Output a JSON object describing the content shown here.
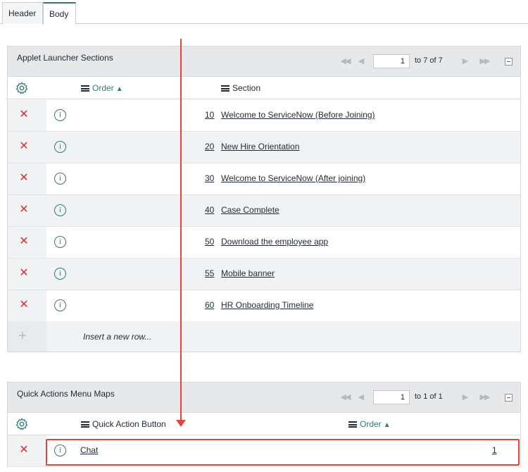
{
  "tabs": [
    {
      "label": "Header"
    },
    {
      "label": "Body"
    }
  ],
  "applet_list": {
    "title": "Applet Launcher Sections",
    "pager": {
      "page_value": "1",
      "count_text": "to 7 of 7"
    },
    "columns": {
      "order": "Order",
      "section": "Section"
    },
    "rows": [
      {
        "order": "10",
        "section": "Welcome to ServiceNow (Before Joining)"
      },
      {
        "order": "20",
        "section": "New Hire Orientation"
      },
      {
        "order": "30",
        "section": "Welcome to ServiceNow (After joining)"
      },
      {
        "order": "40",
        "section": "Case Complete"
      },
      {
        "order": "50",
        "section": "Download the employee app"
      },
      {
        "order": "55",
        "section": "Mobile banner"
      },
      {
        "order": "60",
        "section": "HR Onboarding Timeline"
      }
    ],
    "insert_text": "Insert a new row..."
  },
  "quick_list": {
    "title": "Quick Actions Menu Maps",
    "pager": {
      "page_value": "1",
      "count_text": "to 1 of 1"
    },
    "columns": {
      "button": "Quick Action Button",
      "order": "Order"
    },
    "rows": [
      {
        "button": "Chat",
        "order": "1"
      }
    ]
  },
  "colors": {
    "accent": "#2e7d74",
    "delete": "#d9322c",
    "highlight": "#e1453d"
  }
}
